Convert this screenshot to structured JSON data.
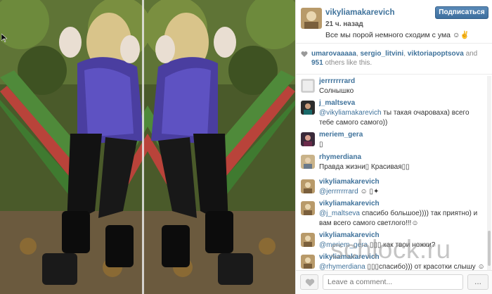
{
  "post": {
    "username": "vikyliamakarevich",
    "time": "21 ч. назад",
    "caption": "Все мы порой немного сходим с ума ☺✌",
    "follow_label": "Подписаться"
  },
  "likes": {
    "liker_1": "umarovaaaaa",
    "liker_2": "sergio_litvini",
    "liker_3": "viktoriapoptsova",
    "and_text": "and",
    "count": "951",
    "suffix": "others like this."
  },
  "comments": [
    {
      "user": "jerrrrrrrard",
      "text": "Солнышко"
    },
    {
      "user": "j_maltseva",
      "mention": "@vikyliamakarevich",
      "text": "ты такая очароваха) всего тебе самого самого))"
    },
    {
      "user": "meriem_gera",
      "text": "▯"
    },
    {
      "user": "rhymerdiana",
      "text": "Правда жизни▯ Красивая▯▯"
    },
    {
      "user": "vikyliamakarevich",
      "mention": "@jerrrrrrrard",
      "text": "☺ ▯✦"
    },
    {
      "user": "vikyliamakarevich",
      "mention": "@j_maltseva",
      "text": "спасибо большое)))) так приятно) и вам всего самого светлого!!!☺"
    },
    {
      "user": "vikyliamakarevich",
      "mention": "@meriem_gera",
      "text": "▯▯▯ как твои ножки?"
    },
    {
      "user": "vikyliamakarevich",
      "mention": "@rhymerdiana",
      "text": "▯▯▯спасибо))) от красотки слышу ☺"
    }
  ],
  "footer": {
    "comment_placeholder": "Leave a comment...",
    "more_label": "..."
  },
  "watermark": "schlock.ru",
  "colors": {
    "link": "#3f729b",
    "follow_button": "#3d6f9e"
  }
}
